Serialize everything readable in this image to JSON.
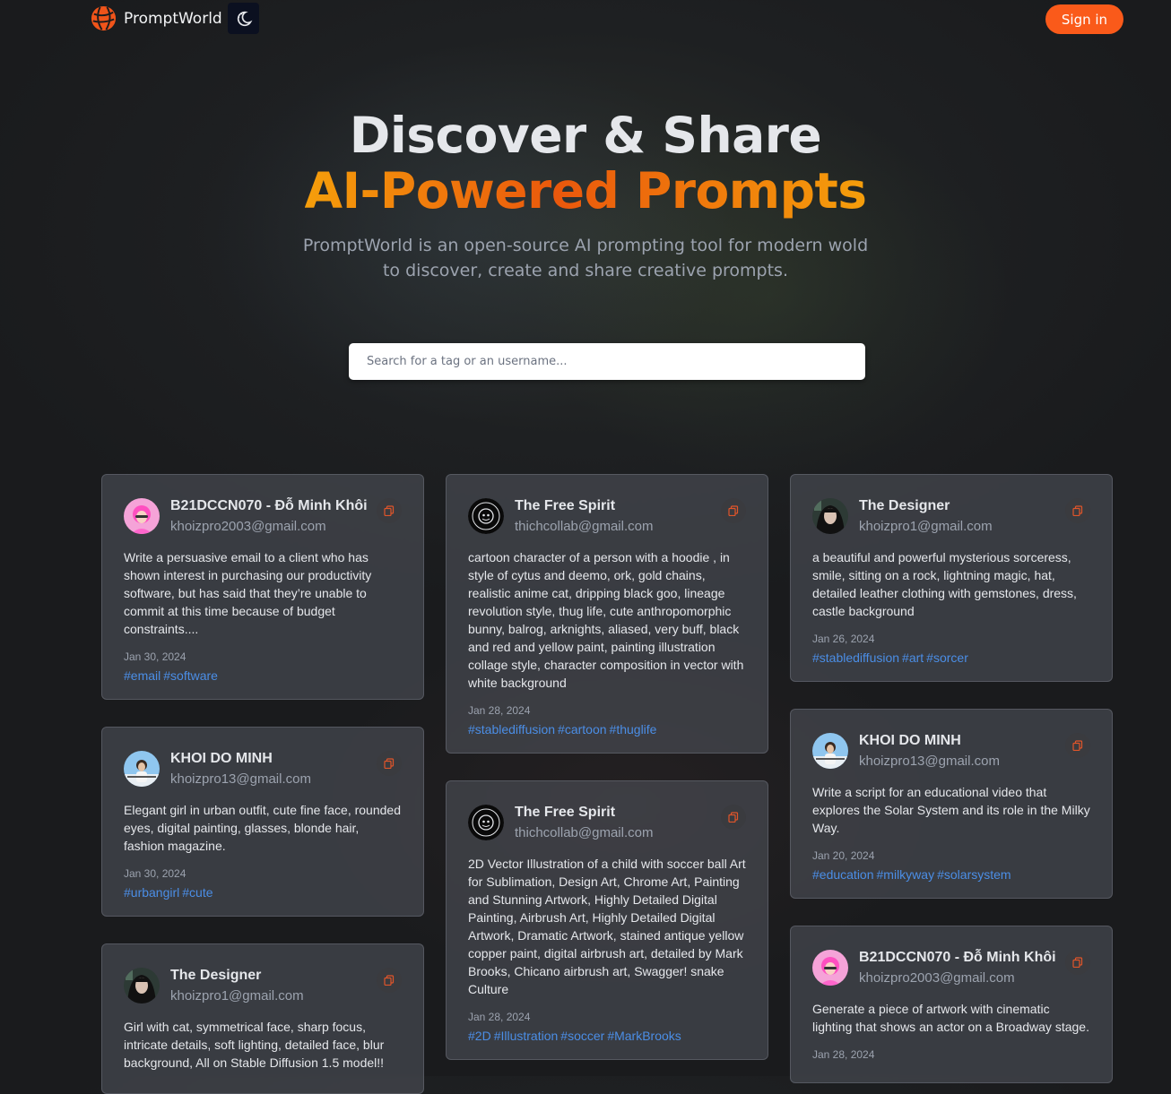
{
  "nav": {
    "brand": "PromptWorld",
    "theme_toggle_icon": "moon-icon",
    "signin_label": "Sign in",
    "accent": "#fa5a1a"
  },
  "hero": {
    "title_line1": "Discover & Share",
    "title_line2": "AI-Powered Prompts",
    "subtitle": "PromptWorld is an open-source AI prompting tool for modern wold to discover, create and share creative prompts."
  },
  "search": {
    "placeholder": "Search for a tag or an username..."
  },
  "cards": [
    {
      "name": "B21DCCN070 - Đỗ Minh Khôi",
      "email": "khoizpro2003@gmail.com",
      "prompt": "Write a persuasive email to a client who has shown interest in purchasing our productivity software, but has said that they’re unable to commit at this time because of budget constraints....",
      "date": "Jan 30, 2024",
      "tags": [
        "#email",
        "#software"
      ],
      "avatar": "pink-girl"
    },
    {
      "name": "The Free Spirit",
      "email": "thichcollab@gmail.com",
      "prompt": "cartoon character of a person with a hoodie , in style of cytus and deemo, ork, gold chains, realistic anime cat, dripping black goo, lineage revolution style, thug life, cute anthropomorphic bunny, balrog, arknights, aliased, very buff, black and red and yellow paint, painting illustration collage style, character composition in vector with white background",
      "date": "Jan 28, 2024",
      "tags": [
        "#stablediffusion",
        "#cartoon",
        "#thuglife"
      ],
      "avatar": "badge"
    },
    {
      "name": "The Designer",
      "email": "khoizpro1@gmail.com",
      "prompt": "a beautiful and powerful mysterious sorceress, smile, sitting on a rock, lightning magic, hat, detailed leather clothing with gemstones, dress, castle background",
      "date": "Jan 26, 2024",
      "tags": [
        "#stablediffusion",
        "#art",
        "#sorcer"
      ],
      "avatar": "dark-girl"
    },
    {
      "name": "KHOI DO MINH",
      "email": "khoizpro13@gmail.com",
      "prompt": "Elegant girl in urban outfit, cute fine face, rounded eyes, digital painting, glasses, blonde hair, fashion magazine.",
      "date": "Jan 30, 2024",
      "tags": [
        "#urbangirl",
        "#cute"
      ],
      "avatar": "sky-person"
    },
    {
      "name": "The Free Spirit",
      "email": "thichcollab@gmail.com",
      "prompt": "2D Vector Illustration of a child with soccer ball Art for Sublimation, Design Art, Chrome Art, Painting and Stunning Artwork, Highly Detailed Digital Painting, Airbrush Art, Highly Detailed Digital Artwork, Dramatic Artwork, stained antique yellow copper paint, digital airbrush art, detailed by Mark Brooks, Chicano airbrush art, Swagger! snake Culture",
      "date": "Jan 28, 2024",
      "tags": [
        "#2D",
        "#Illustration",
        "#soccer",
        "#MarkBrooks"
      ],
      "avatar": "badge"
    },
    {
      "name": "KHOI DO MINH",
      "email": "khoizpro13@gmail.com",
      "prompt": "Write a script for an educational video that explores the Solar System and its role in the Milky Way.",
      "date": "Jan 20, 2024",
      "tags": [
        "#education",
        "#milkyway",
        "#solarsystem"
      ],
      "avatar": "sky-person"
    },
    {
      "name": "The Designer",
      "email": "khoizpro1@gmail.com",
      "prompt": "Girl with cat, symmetrical face, sharp focus, intricate details, soft lighting, detailed face, blur background, All on Stable Diffusion 1.5 model!!",
      "date": "",
      "tags": [],
      "avatar": "dark-girl"
    },
    {
      "name": "B21DCCN070 - Đỗ Minh Khôi",
      "email": "khoizpro2003@gmail.com",
      "prompt": "Generate a piece of artwork with cinematic lighting that shows an actor on a Broadway stage.",
      "date": "Jan 28, 2024",
      "tags": [],
      "avatar": "pink-girl"
    }
  ]
}
